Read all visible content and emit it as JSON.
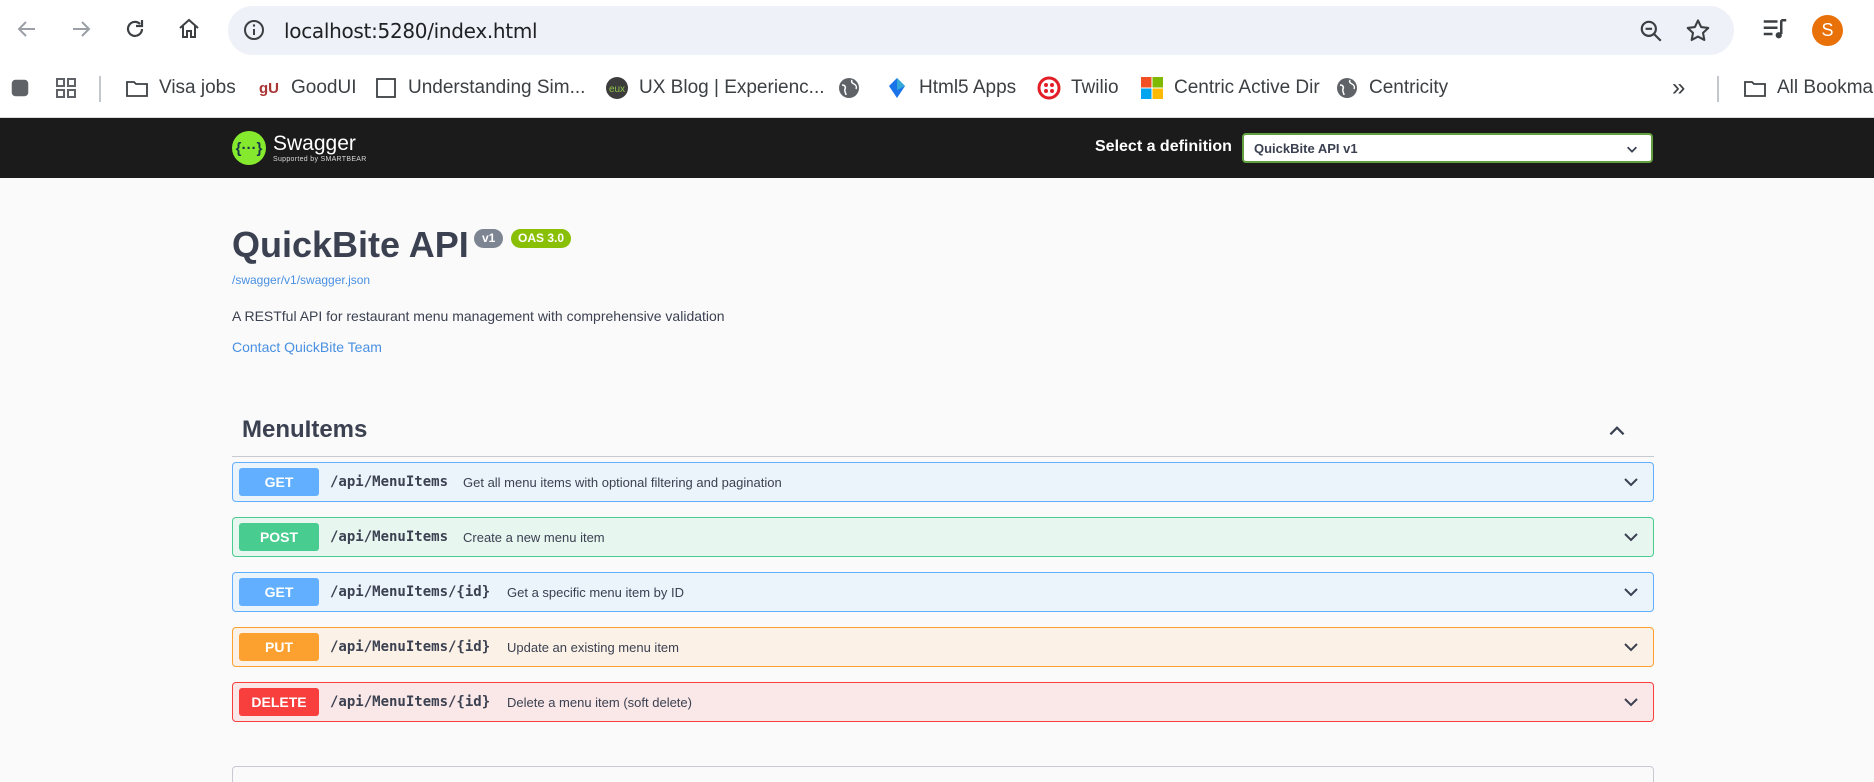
{
  "browser": {
    "url": "localhost:5280/index.html",
    "avatar_letter": "S",
    "bookmarks": [
      {
        "label": "Visa jobs",
        "icon": "folder-icon"
      },
      {
        "label": "GoodUI",
        "icon": "goodui-icon"
      },
      {
        "label": "Understanding Sim...",
        "icon": "page-icon"
      },
      {
        "label": "UX Blog | Experienc...",
        "icon": "uxblog-icon"
      },
      {
        "label": "",
        "icon": "globe-icon"
      },
      {
        "label": "Html5 Apps",
        "icon": "html5-icon"
      },
      {
        "label": "Twilio",
        "icon": "twilio-icon"
      },
      {
        "label": "Centric Active Dir",
        "icon": "microsoft-icon"
      },
      {
        "label": "Centricity",
        "icon": "globe-icon"
      }
    ],
    "all_bookmarks": "All Bookmarks",
    "more": "»"
  },
  "swagger": {
    "logo_text": "Swagger",
    "logo_sub": "Supported by SMARTBEAR",
    "definition_label": "Select a definition",
    "definition_value": "QuickBite API v1"
  },
  "info": {
    "title": "QuickBite API",
    "version": "v1",
    "oas": "OAS 3.0",
    "json_link": "/swagger/v1/swagger.json",
    "description": "A RESTful API for restaurant menu management with comprehensive validation",
    "contact": "Contact QuickBite Team"
  },
  "tag": {
    "name": "MenuItems",
    "operations": [
      {
        "method": "GET",
        "path": "/api/MenuItems",
        "summary": "Get all menu items with optional filtering and pagination"
      },
      {
        "method": "POST",
        "path": "/api/MenuItems",
        "summary": "Create a new menu item"
      },
      {
        "method": "GET",
        "path": "/api/MenuItems/{id}",
        "summary": "Get a specific menu item by ID"
      },
      {
        "method": "PUT",
        "path": "/api/MenuItems/{id}",
        "summary": "Update an existing menu item"
      },
      {
        "method": "DELETE",
        "path": "/api/MenuItems/{id}",
        "summary": "Delete a menu item (soft delete)"
      }
    ]
  },
  "colors": {
    "get": "#61affe",
    "post": "#49cc90",
    "put": "#fca130",
    "delete": "#f93e3e",
    "topbar": "#1b1b1b",
    "link": "#4990e2"
  }
}
